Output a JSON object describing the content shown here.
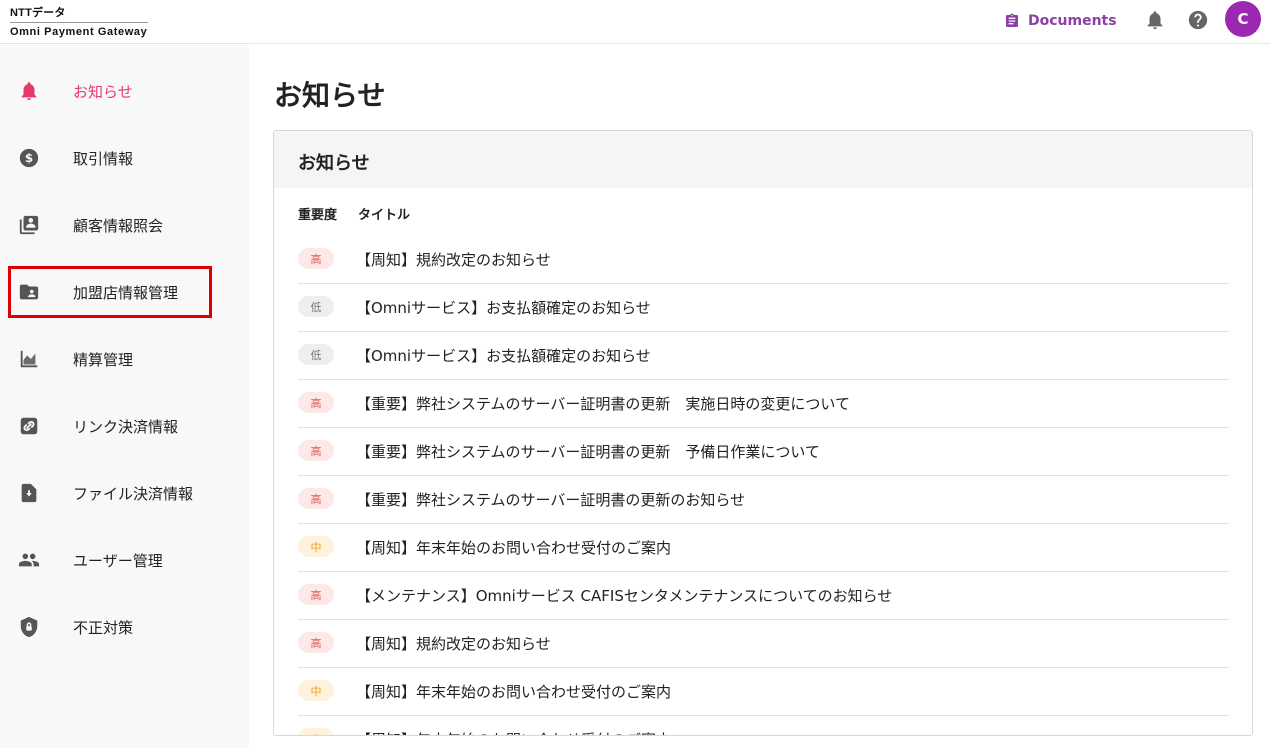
{
  "brand": {
    "line1": "NTTデータ",
    "line2": "Omni Payment Gateway"
  },
  "header": {
    "documents_label": "Documents",
    "avatar_initial": "C"
  },
  "sidebar": {
    "items": [
      {
        "label": "お知らせ",
        "icon": "bell-icon"
      },
      {
        "label": "取引情報",
        "icon": "dollar-icon"
      },
      {
        "label": "顧客情報照会",
        "icon": "contacts-icon"
      },
      {
        "label": "加盟店情報管理",
        "icon": "folder-person-icon"
      },
      {
        "label": "精算管理",
        "icon": "area-chart-icon"
      },
      {
        "label": "リンク決済情報",
        "icon": "link-icon"
      },
      {
        "label": "ファイル決済情報",
        "icon": "file-upload-icon"
      },
      {
        "label": "ユーザー管理",
        "icon": "people-icon"
      },
      {
        "label": "不正対策",
        "icon": "shield-lock-icon"
      }
    ]
  },
  "main": {
    "page_title": "お知らせ",
    "card_title": "お知らせ",
    "columns": {
      "importance": "重要度",
      "title": "タイトル"
    },
    "notices": [
      {
        "level": "高",
        "kind": "high",
        "title": "【周知】規約改定のお知らせ"
      },
      {
        "level": "低",
        "kind": "low",
        "title": "【Omniサービス】お支払額確定のお知らせ"
      },
      {
        "level": "低",
        "kind": "low",
        "title": "【Omniサービス】お支払額確定のお知らせ"
      },
      {
        "level": "高",
        "kind": "high",
        "title": "【重要】弊社システムのサーバー証明書の更新　実施日時の変更について"
      },
      {
        "level": "高",
        "kind": "high",
        "title": "【重要】弊社システムのサーバー証明書の更新　予備日作業について"
      },
      {
        "level": "高",
        "kind": "high",
        "title": "【重要】弊社システムのサーバー証明書の更新のお知らせ"
      },
      {
        "level": "中",
        "kind": "mid",
        "title": "【周知】年末年始のお問い合わせ受付のご案内"
      },
      {
        "level": "高",
        "kind": "high",
        "title": "【メンテナンス】Omniサービス CAFISセンタメンテナンスについてのお知らせ"
      },
      {
        "level": "高",
        "kind": "high",
        "title": "【周知】規約改定のお知らせ"
      },
      {
        "level": "中",
        "kind": "mid",
        "title": "【周知】年末年始のお問い合わせ受付のご案内"
      },
      {
        "level": "中",
        "kind": "mid",
        "title": "【周知】年末年始のお問い合わせ受付のご案内"
      }
    ]
  },
  "colors": {
    "accent": "#e8376a",
    "brand_purple": "#8e3fa7",
    "avatar_bg": "#9c27b0",
    "highlight_border": "#e00000"
  }
}
